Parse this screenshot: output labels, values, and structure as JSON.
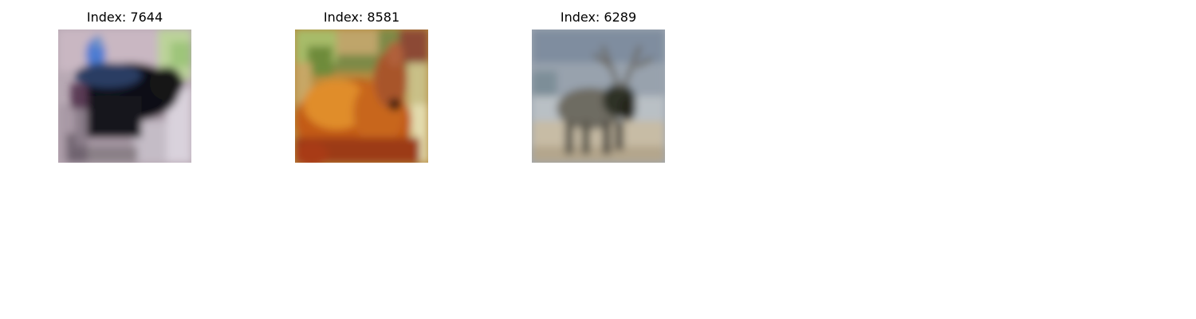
{
  "panels": [
    {
      "title": "Index: 7644"
    },
    {
      "title": "Index: 8581"
    },
    {
      "title": "Index: 6289"
    }
  ]
}
